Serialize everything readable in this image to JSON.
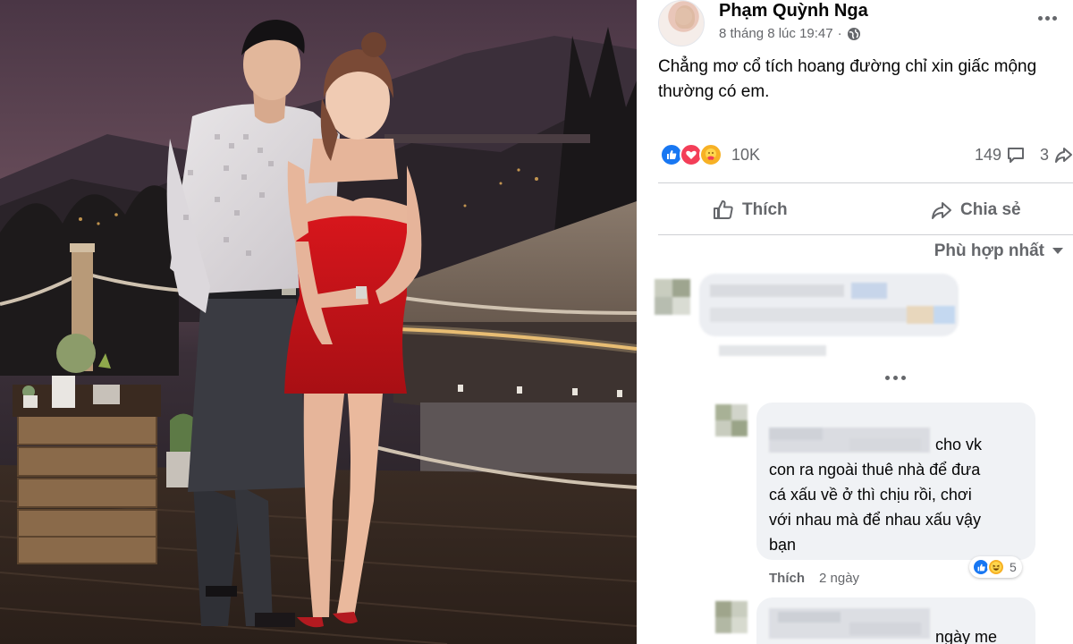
{
  "post": {
    "author": "Phạm Quỳnh Nga",
    "date": "8 tháng 8 lúc 19:47",
    "separator": "·",
    "text": "Chẳng mơ cổ tích hoang đường chỉ xin giấc mộng thường có em.",
    "reactions_count": "10K",
    "comments_count": "149",
    "shares_count": "3",
    "like_label": "Thích",
    "share_label": "Chia sẻ",
    "sort_label": "Phù hợp nhất"
  },
  "comments": [
    {
      "visible_text": "cho vk",
      "lines": [
        "con ra ngoài thuê nhà để đưa",
        "cá xấu về ở thì chịu rồi, chơi",
        "với nhau mà để nhau xấu vậy",
        "bạn"
      ],
      "like_label": "Thích",
      "time": "2 ngày",
      "reactions_count": "5"
    },
    {
      "visible_text": "ngày me"
    }
  ],
  "icons": {
    "like_reaction": "like-icon",
    "love_reaction": "heart-icon",
    "care_reaction": "care-icon",
    "haha_reaction": "haha-icon",
    "comment": "comment-icon",
    "share": "share-icon",
    "globe": "globe-icon",
    "sort": "caret-down-icon"
  },
  "colors": {
    "like_blue": "#1877f2",
    "love_red": "#f33e58",
    "care_yellow": "#f7b125",
    "text_secondary": "#65676b",
    "bubble_bg": "#f0f2f5"
  }
}
